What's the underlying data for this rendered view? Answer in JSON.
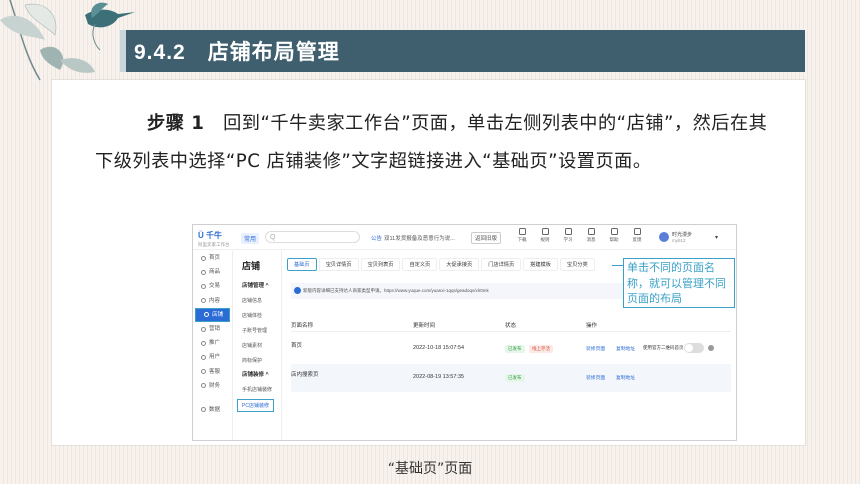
{
  "section": {
    "number": "9.4.2",
    "title": "店铺布局管理"
  },
  "paragraph": {
    "step": "步骤 1",
    "text": "回到“千牛卖家工作台”页面，单击左侧列表中的“店铺”，然后在其下级列表中选择“PC 店铺装修”文字超链接进入“基础页”设置页面。"
  },
  "caption": "“基础页”页面",
  "callout": "单击不同的页面名称，就可以管理不同页面的布局",
  "screenshot": {
    "logo": "千牛",
    "logo_sub": "阿里卖家工作台",
    "home": "常用",
    "search_placeholder": "Q",
    "notice_tag": "公告",
    "notice_text": "双11发货报备及恶意行为说...",
    "back_old": "返回旧版",
    "tools": [
      "下载",
      "规则",
      "学习",
      "消息",
      "帮助",
      "反馈"
    ],
    "user_name": "时光漫步",
    "user_id": "my912",
    "nav1": [
      "首页",
      "商品",
      "交易",
      "内容",
      "店铺",
      "营销",
      "推广",
      "用户",
      "客服",
      "财务",
      "数据"
    ],
    "nav2_title": "店铺",
    "nav2": [
      {
        "type": "g",
        "label": "店铺管理  ^"
      },
      {
        "type": "i",
        "label": "店铺信息"
      },
      {
        "type": "i",
        "label": "店铺体检"
      },
      {
        "type": "i",
        "label": "子账号管理"
      },
      {
        "type": "i",
        "label": "店铺素材"
      },
      {
        "type": "i",
        "label": "商标保护"
      },
      {
        "type": "g",
        "label": "店铺装修  ^"
      },
      {
        "type": "i",
        "label": "手机店铺装修"
      }
    ],
    "nav2_selected": "PC店铺装修",
    "tabs": [
      "基础页",
      "宝贝详情页",
      "宝贝列表页",
      "自定义页",
      "大促承接页",
      "门店详情页",
      "搭建模板",
      "宝贝分类"
    ],
    "info": "新版内容详细已支持达人商家类型申请。https://www.yuque.com/yuanxi-1qqs/geadoqv/xlr0mk",
    "table_headers": [
      "页面名称",
      "更新时间",
      "状态",
      "操作"
    ],
    "rows": [
      {
        "name": "首页",
        "time": "2022-10-18 15:07:54",
        "status": "已发布",
        "status2": "线上存活",
        "op1": "装修页面",
        "op2": "复制地址",
        "op3": "使用官方二维码首页"
      },
      {
        "name": "店内搜索页",
        "time": "2022-08-19 13:57:35",
        "status": "已发布",
        "op1": "装修页面",
        "op2": "复制地址"
      }
    ]
  }
}
